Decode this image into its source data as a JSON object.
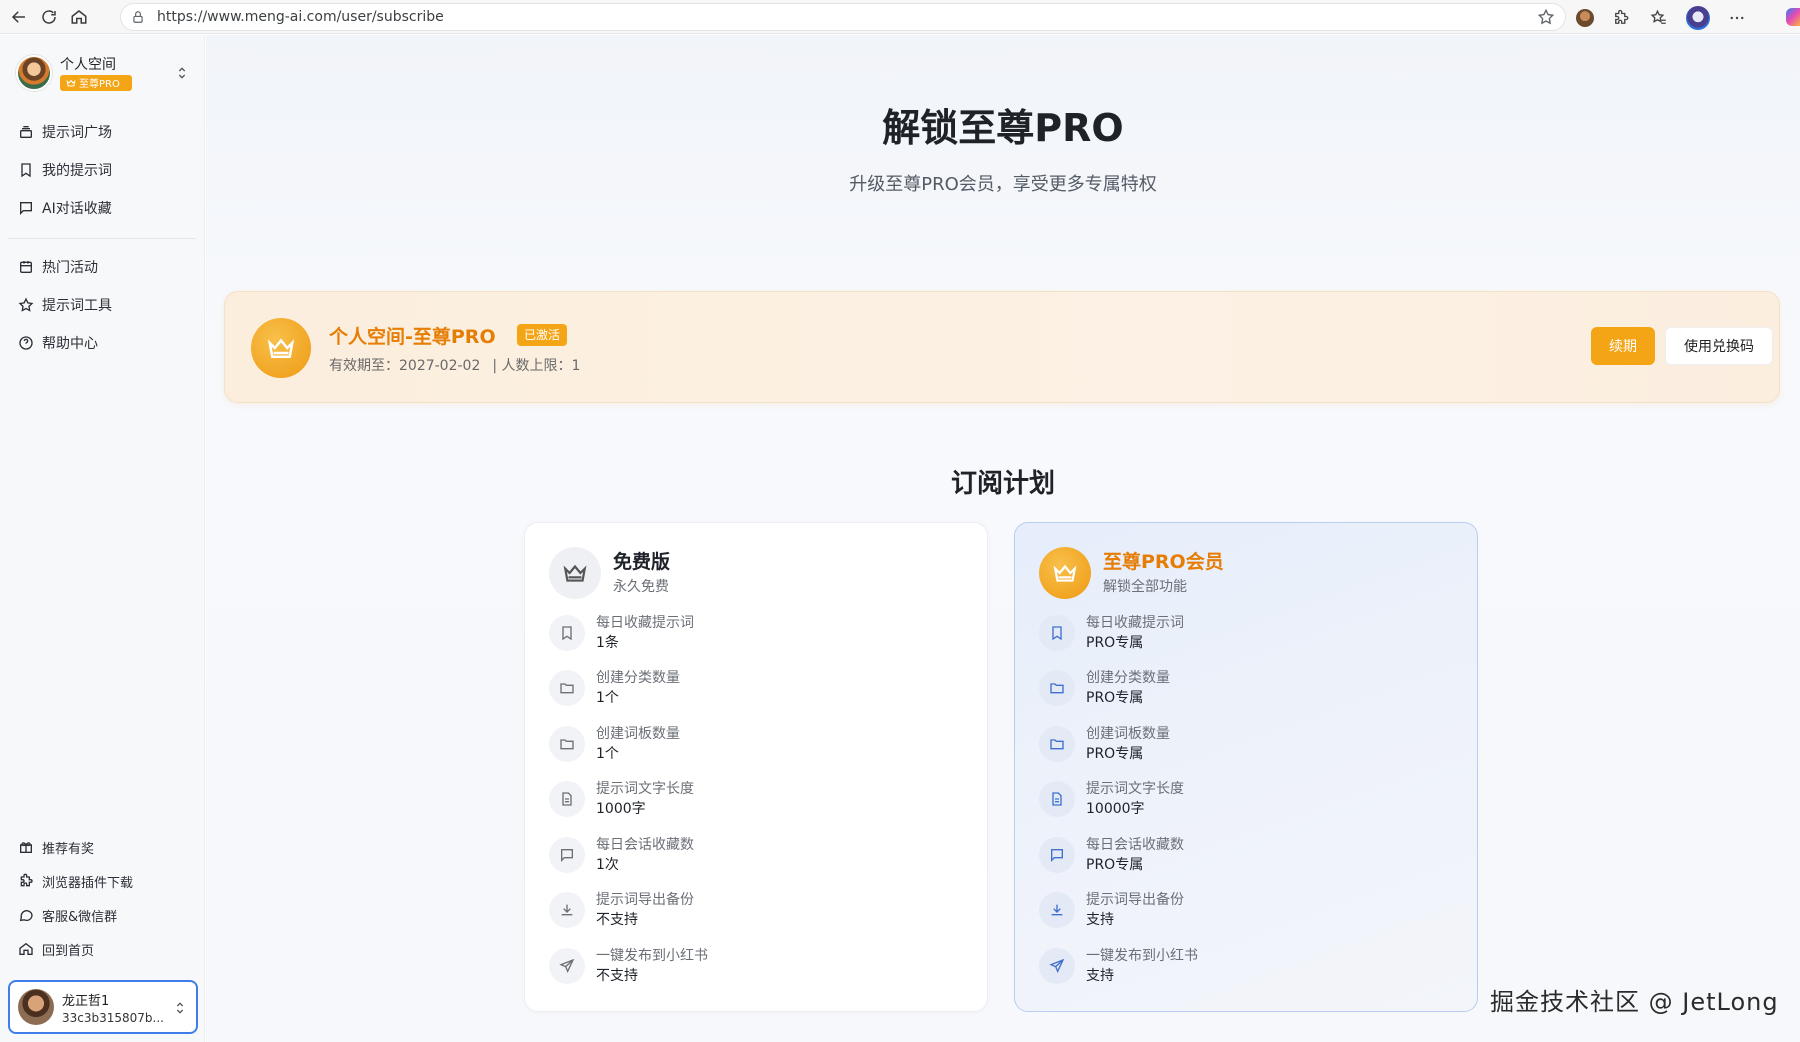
{
  "browser": {
    "url": "https://www.meng-ai.com/user/subscribe"
  },
  "sidebar": {
    "space_name": "个人空间",
    "space_badge": "至尊PRO",
    "nav_top": [
      {
        "label": "提示词广场",
        "icon": "stack-icon"
      },
      {
        "label": "我的提示词",
        "icon": "bookmark-icon"
      },
      {
        "label": "AI对话收藏",
        "icon": "chat-icon"
      }
    ],
    "nav_mid": [
      {
        "label": "热门活动",
        "icon": "calendar-icon"
      },
      {
        "label": "提示词工具",
        "icon": "star-icon"
      },
      {
        "label": "帮助中心",
        "icon": "help-icon"
      }
    ],
    "nav_bottom": [
      {
        "label": "推荐有奖",
        "icon": "gift-icon"
      },
      {
        "label": "浏览器插件下载",
        "icon": "puzzle-icon"
      },
      {
        "label": "客服&微信群",
        "icon": "message-icon"
      },
      {
        "label": "回到首页",
        "icon": "home-icon"
      }
    ],
    "user": {
      "name": "龙正哲1",
      "id": "33c3b315807b..."
    }
  },
  "hero": {
    "title": "解锁至尊PRO",
    "subtitle": "升级至尊PRO会员，享受更多专属特权"
  },
  "status": {
    "title": "个人空间-至尊PRO",
    "tag": "已激活",
    "expiry": "有效期至：2027-02-02",
    "limit": "| 人数上限：1",
    "renew_label": "续期",
    "redeem_label": "使用兑换码"
  },
  "plans_section": {
    "title": "订阅计划"
  },
  "plans": {
    "free": {
      "name": "免费版",
      "desc": "永久免费",
      "features": [
        {
          "label": "每日收藏提示词",
          "value": "1条",
          "icon": "bookmark-icon"
        },
        {
          "label": "创建分类数量",
          "value": "1个",
          "icon": "folder-icon"
        },
        {
          "label": "创建词板数量",
          "value": "1个",
          "icon": "folder-icon"
        },
        {
          "label": "提示词文字长度",
          "value": "1000字",
          "icon": "document-icon"
        },
        {
          "label": "每日会话收藏数",
          "value": "1次",
          "icon": "chat-icon"
        },
        {
          "label": "提示词导出备份",
          "value": "不支持",
          "icon": "download-icon"
        },
        {
          "label": "一键发布到小红书",
          "value": "不支持",
          "icon": "send-icon"
        }
      ]
    },
    "pro": {
      "name": "至尊PRO会员",
      "desc": "解锁全部功能",
      "features": [
        {
          "label": "每日收藏提示词",
          "value": "PRO专属",
          "icon": "bookmark-icon"
        },
        {
          "label": "创建分类数量",
          "value": "PRO专属",
          "icon": "folder-icon"
        },
        {
          "label": "创建词板数量",
          "value": "PRO专属",
          "icon": "folder-icon"
        },
        {
          "label": "提示词文字长度",
          "value": "10000字",
          "icon": "document-icon"
        },
        {
          "label": "每日会话收藏数",
          "value": "PRO专属",
          "icon": "chat-icon"
        },
        {
          "label": "提示词导出备份",
          "value": "支持",
          "icon": "download-icon"
        },
        {
          "label": "一键发布到小红书",
          "value": "支持",
          "icon": "send-icon"
        }
      ]
    }
  },
  "watermark": "掘金技术社区 @ JetLong",
  "colors": {
    "accent": "#f4a516",
    "pro_text": "#e67e06",
    "focus_border": "#3f7ee8"
  }
}
